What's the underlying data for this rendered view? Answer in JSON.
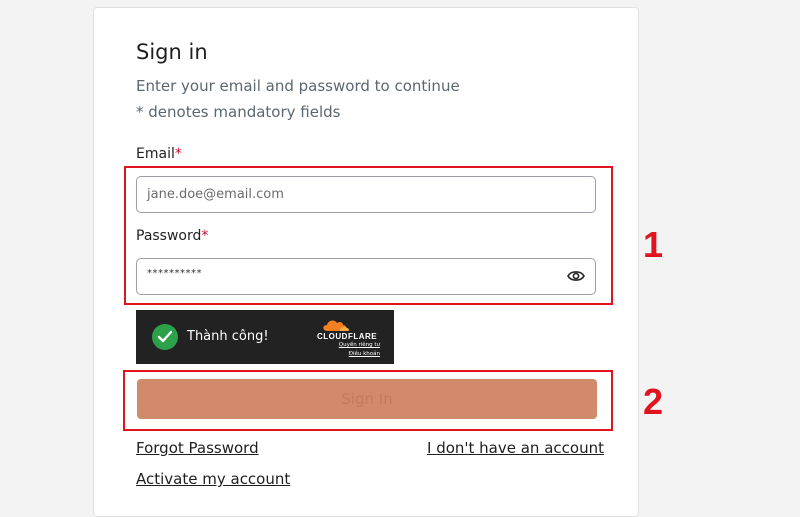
{
  "form": {
    "title": "Sign in",
    "subtitle": "Enter your email and password to continue",
    "mandatory_note": "* denotes mandatory fields",
    "email_label": "Email",
    "password_label": "Password",
    "required_mark": "*",
    "email_value": "jane.doe@email.com",
    "password_value": "**********",
    "signin_label": "Sign In",
    "forgot_password": "Forgot Password",
    "no_account": "I don't have an account",
    "activate_account": "Activate my account"
  },
  "captcha": {
    "status": "Thành công!",
    "brand": "CLOUDFLARE",
    "privacy_link": "Quyền riêng tư",
    "terms_link": "Điều khoản"
  },
  "annotations": {
    "marker_1": "1",
    "marker_2": "2"
  },
  "colors": {
    "highlight": "#e0141e",
    "button": "#d18a6a",
    "success": "#2da04a",
    "cloudflare_orange": "#f38020"
  }
}
